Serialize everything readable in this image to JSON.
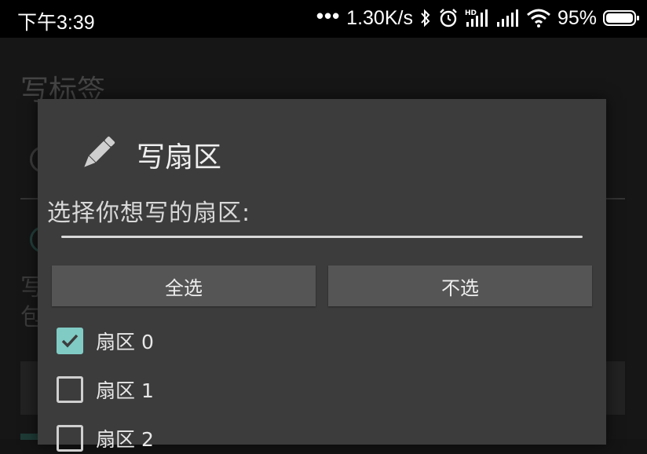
{
  "status_bar": {
    "time": "下午3:39",
    "dots": "•••",
    "net_speed": "1.30K/s",
    "battery": "95%",
    "icons": [
      "bluetooth-icon",
      "alarm-icon",
      "hd-signal-icon",
      "signal-icon",
      "wifi-icon",
      "battery-icon"
    ]
  },
  "background": {
    "title": "写标签",
    "text_fragment": "写包"
  },
  "dialog": {
    "icon": "pencil-icon",
    "title": "写扇区",
    "prompt": "选择你想写的扇区:",
    "input_value": "",
    "select_all_label": "全选",
    "select_none_label": "不选",
    "sectors": [
      {
        "label": "扇区 0",
        "checked": true
      },
      {
        "label": "扇区 1",
        "checked": false
      },
      {
        "label": "扇区 2",
        "checked": false
      }
    ]
  },
  "colors": {
    "accent": "#80cbc4",
    "dialog_bg": "#3c3c3c",
    "button_bg": "#555555"
  }
}
